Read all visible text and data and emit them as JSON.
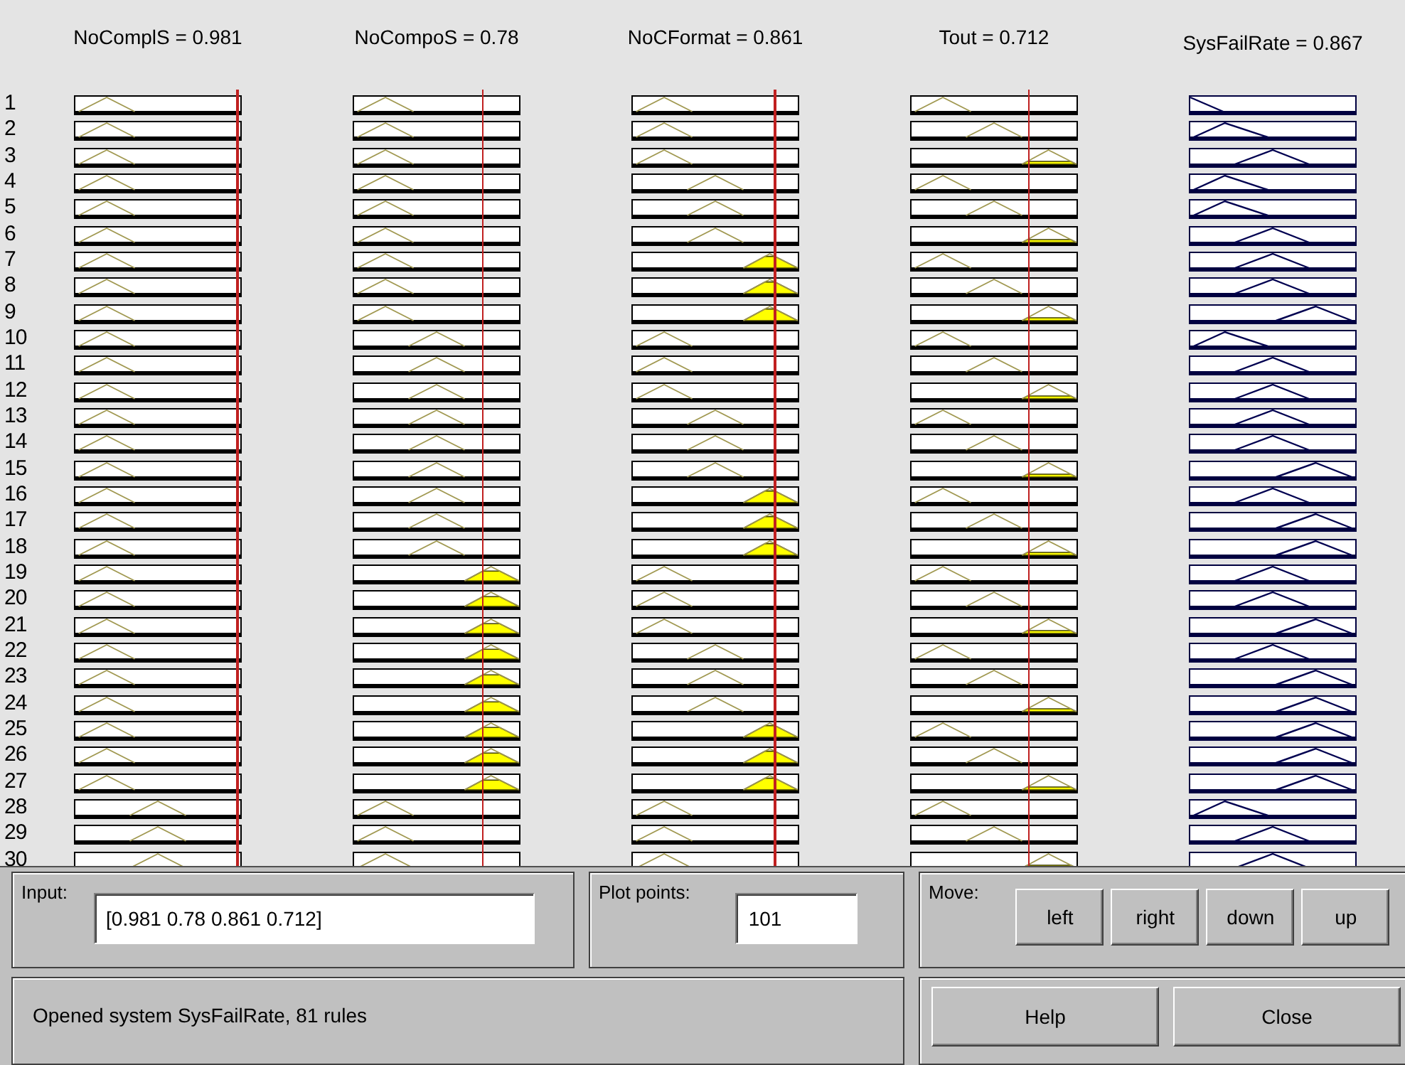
{
  "variables": [
    {
      "label": "NoComplS = 0.981",
      "kind": "input"
    },
    {
      "label": "NoCompoS = 0.78",
      "kind": "input"
    },
    {
      "label": "NoCFormat = 0.861",
      "kind": "input"
    },
    {
      "label": "Tout = 0.712",
      "kind": "input"
    },
    {
      "label": "SysFailRate = 0.867",
      "kind": "output"
    }
  ],
  "rules": [
    {
      "number": "1",
      "inputs": [
        {
          "kind": "low",
          "fired": false
        },
        {
          "kind": "low",
          "fired": false
        },
        {
          "kind": "low",
          "fired": false
        },
        {
          "kind": "low",
          "fired": false
        }
      ],
      "output": {
        "kind": "very-low"
      }
    },
    {
      "number": "2",
      "inputs": [
        {
          "kind": "low",
          "fired": false
        },
        {
          "kind": "low",
          "fired": false
        },
        {
          "kind": "low",
          "fired": false
        },
        {
          "kind": "mid",
          "fired": false
        }
      ],
      "output": {
        "kind": "low"
      }
    },
    {
      "number": "3",
      "inputs": [
        {
          "kind": "low",
          "fired": false
        },
        {
          "kind": "low",
          "fired": false
        },
        {
          "kind": "low",
          "fired": false
        },
        {
          "kind": "high",
          "fired": true
        }
      ],
      "output": {
        "kind": "medium"
      }
    },
    {
      "number": "4",
      "inputs": [
        {
          "kind": "low",
          "fired": false
        },
        {
          "kind": "low",
          "fired": false
        },
        {
          "kind": "mid",
          "fired": false
        },
        {
          "kind": "low",
          "fired": false
        }
      ],
      "output": {
        "kind": "low"
      }
    },
    {
      "number": "5",
      "inputs": [
        {
          "kind": "low",
          "fired": false
        },
        {
          "kind": "low",
          "fired": false
        },
        {
          "kind": "mid",
          "fired": false
        },
        {
          "kind": "mid",
          "fired": false
        }
      ],
      "output": {
        "kind": "low"
      }
    },
    {
      "number": "6",
      "inputs": [
        {
          "kind": "low",
          "fired": false
        },
        {
          "kind": "low",
          "fired": false
        },
        {
          "kind": "mid",
          "fired": false
        },
        {
          "kind": "high",
          "fired": true
        }
      ],
      "output": {
        "kind": "medium"
      }
    },
    {
      "number": "7",
      "inputs": [
        {
          "kind": "low",
          "fired": false
        },
        {
          "kind": "low",
          "fired": false
        },
        {
          "kind": "high",
          "fired": true
        },
        {
          "kind": "low",
          "fired": false
        }
      ],
      "output": {
        "kind": "medium"
      }
    },
    {
      "number": "8",
      "inputs": [
        {
          "kind": "low",
          "fired": false
        },
        {
          "kind": "low",
          "fired": false
        },
        {
          "kind": "high",
          "fired": true
        },
        {
          "kind": "mid",
          "fired": false
        }
      ],
      "output": {
        "kind": "medium"
      }
    },
    {
      "number": "9",
      "inputs": [
        {
          "kind": "low",
          "fired": false
        },
        {
          "kind": "low",
          "fired": false
        },
        {
          "kind": "high",
          "fired": true
        },
        {
          "kind": "high",
          "fired": true
        }
      ],
      "output": {
        "kind": "high"
      }
    },
    {
      "number": "10",
      "inputs": [
        {
          "kind": "low",
          "fired": false
        },
        {
          "kind": "mid",
          "fired": false
        },
        {
          "kind": "low",
          "fired": false
        },
        {
          "kind": "low",
          "fired": false
        }
      ],
      "output": {
        "kind": "low"
      }
    },
    {
      "number": "11",
      "inputs": [
        {
          "kind": "low",
          "fired": false
        },
        {
          "kind": "mid",
          "fired": false
        },
        {
          "kind": "low",
          "fired": false
        },
        {
          "kind": "mid",
          "fired": false
        }
      ],
      "output": {
        "kind": "medium"
      }
    },
    {
      "number": "12",
      "inputs": [
        {
          "kind": "low",
          "fired": false
        },
        {
          "kind": "mid",
          "fired": false
        },
        {
          "kind": "low",
          "fired": false
        },
        {
          "kind": "high",
          "fired": true
        }
      ],
      "output": {
        "kind": "medium"
      }
    },
    {
      "number": "13",
      "inputs": [
        {
          "kind": "low",
          "fired": false
        },
        {
          "kind": "mid",
          "fired": false
        },
        {
          "kind": "mid",
          "fired": false
        },
        {
          "kind": "low",
          "fired": false
        }
      ],
      "output": {
        "kind": "medium"
      }
    },
    {
      "number": "14",
      "inputs": [
        {
          "kind": "low",
          "fired": false
        },
        {
          "kind": "mid",
          "fired": false
        },
        {
          "kind": "mid",
          "fired": false
        },
        {
          "kind": "mid",
          "fired": false
        }
      ],
      "output": {
        "kind": "medium"
      }
    },
    {
      "number": "15",
      "inputs": [
        {
          "kind": "low",
          "fired": false
        },
        {
          "kind": "mid",
          "fired": false
        },
        {
          "kind": "mid",
          "fired": false
        },
        {
          "kind": "high",
          "fired": true
        }
      ],
      "output": {
        "kind": "high"
      }
    },
    {
      "number": "16",
      "inputs": [
        {
          "kind": "low",
          "fired": false
        },
        {
          "kind": "mid",
          "fired": false
        },
        {
          "kind": "high",
          "fired": true
        },
        {
          "kind": "low",
          "fired": false
        }
      ],
      "output": {
        "kind": "medium"
      }
    },
    {
      "number": "17",
      "inputs": [
        {
          "kind": "low",
          "fired": false
        },
        {
          "kind": "mid",
          "fired": false
        },
        {
          "kind": "high",
          "fired": true
        },
        {
          "kind": "mid",
          "fired": false
        }
      ],
      "output": {
        "kind": "high"
      }
    },
    {
      "number": "18",
      "inputs": [
        {
          "kind": "low",
          "fired": false
        },
        {
          "kind": "mid",
          "fired": false
        },
        {
          "kind": "high",
          "fired": true
        },
        {
          "kind": "high",
          "fired": true
        }
      ],
      "output": {
        "kind": "high"
      }
    },
    {
      "number": "19",
      "inputs": [
        {
          "kind": "low",
          "fired": false
        },
        {
          "kind": "high",
          "fired": true
        },
        {
          "kind": "low",
          "fired": false
        },
        {
          "kind": "low",
          "fired": false
        }
      ],
      "output": {
        "kind": "medium"
      }
    },
    {
      "number": "20",
      "inputs": [
        {
          "kind": "low",
          "fired": false
        },
        {
          "kind": "high",
          "fired": true
        },
        {
          "kind": "low",
          "fired": false
        },
        {
          "kind": "mid",
          "fired": false
        }
      ],
      "output": {
        "kind": "medium"
      }
    },
    {
      "number": "21",
      "inputs": [
        {
          "kind": "low",
          "fired": false
        },
        {
          "kind": "high",
          "fired": true
        },
        {
          "kind": "low",
          "fired": false
        },
        {
          "kind": "high",
          "fired": true
        }
      ],
      "output": {
        "kind": "high"
      }
    },
    {
      "number": "22",
      "inputs": [
        {
          "kind": "low",
          "fired": false
        },
        {
          "kind": "high",
          "fired": true
        },
        {
          "kind": "mid",
          "fired": false
        },
        {
          "kind": "low",
          "fired": false
        }
      ],
      "output": {
        "kind": "medium"
      }
    },
    {
      "number": "23",
      "inputs": [
        {
          "kind": "low",
          "fired": false
        },
        {
          "kind": "high",
          "fired": true
        },
        {
          "kind": "mid",
          "fired": false
        },
        {
          "kind": "mid",
          "fired": false
        }
      ],
      "output": {
        "kind": "high"
      }
    },
    {
      "number": "24",
      "inputs": [
        {
          "kind": "low",
          "fired": false
        },
        {
          "kind": "high",
          "fired": true
        },
        {
          "kind": "mid",
          "fired": false
        },
        {
          "kind": "high",
          "fired": true
        }
      ],
      "output": {
        "kind": "high"
      }
    },
    {
      "number": "25",
      "inputs": [
        {
          "kind": "low",
          "fired": false
        },
        {
          "kind": "high",
          "fired": true
        },
        {
          "kind": "high",
          "fired": true
        },
        {
          "kind": "low",
          "fired": false
        }
      ],
      "output": {
        "kind": "high"
      }
    },
    {
      "number": "26",
      "inputs": [
        {
          "kind": "low",
          "fired": false
        },
        {
          "kind": "high",
          "fired": true
        },
        {
          "kind": "high",
          "fired": true
        },
        {
          "kind": "mid",
          "fired": false
        }
      ],
      "output": {
        "kind": "high"
      }
    },
    {
      "number": "27",
      "inputs": [
        {
          "kind": "low",
          "fired": false
        },
        {
          "kind": "high",
          "fired": true
        },
        {
          "kind": "high",
          "fired": true
        },
        {
          "kind": "high",
          "fired": true
        }
      ],
      "output": {
        "kind": "high"
      }
    },
    {
      "number": "28",
      "inputs": [
        {
          "kind": "mid",
          "fired": false
        },
        {
          "kind": "low",
          "fired": false
        },
        {
          "kind": "low",
          "fired": false
        },
        {
          "kind": "low",
          "fired": false
        }
      ],
      "output": {
        "kind": "low"
      }
    },
    {
      "number": "29",
      "inputs": [
        {
          "kind": "mid",
          "fired": false
        },
        {
          "kind": "low",
          "fired": false
        },
        {
          "kind": "low",
          "fired": false
        },
        {
          "kind": "mid",
          "fired": false
        }
      ],
      "output": {
        "kind": "medium"
      }
    },
    {
      "number": "30",
      "inputs": [
        {
          "kind": "mid",
          "fired": false
        },
        {
          "kind": "low",
          "fired": false
        },
        {
          "kind": "low",
          "fired": false
        },
        {
          "kind": "high",
          "fired": true
        }
      ],
      "output": {
        "kind": "medium"
      }
    }
  ],
  "input_panel": {
    "label": "Input:",
    "value": "[0.981 0.78 0.861 0.712]"
  },
  "plot_points": {
    "label": "Plot points:",
    "value": "101"
  },
  "move": {
    "label": "Move:",
    "buttons": [
      "left",
      "right",
      "down",
      "up"
    ]
  },
  "status": "Opened system SysFailRate, 81 rules",
  "buttons": [
    "Help",
    "Close"
  ]
}
